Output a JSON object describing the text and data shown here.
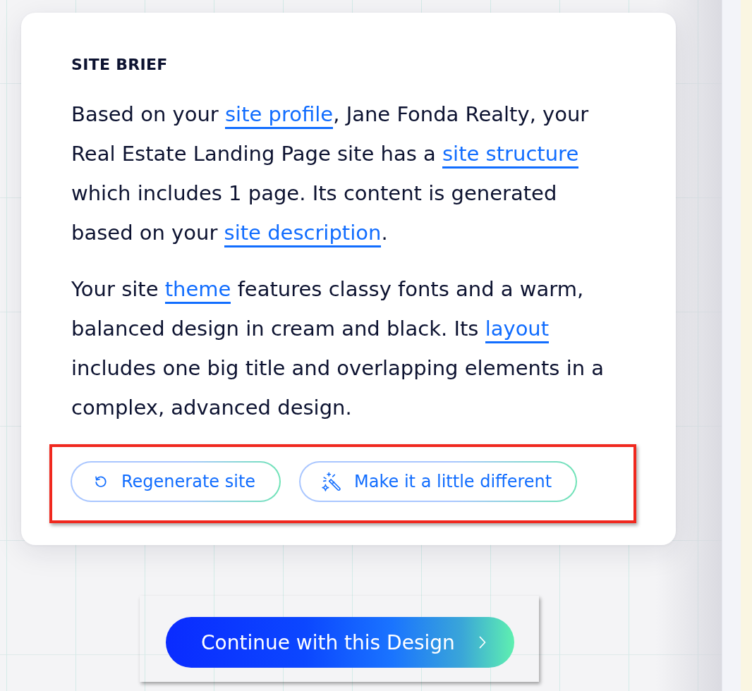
{
  "brief": {
    "title": "SITE BRIEF",
    "paragraphs": [
      {
        "segments": [
          {
            "kind": "text",
            "text": "Based on your "
          },
          {
            "kind": "link",
            "text": "site profile"
          },
          {
            "kind": "text",
            "text": ", Jane Fonda Realty, your Real Estate Landing Page site has a "
          },
          {
            "kind": "link",
            "text": "site structure"
          },
          {
            "kind": "text",
            "text": " which includes 1 page. Its content is generated based on your "
          },
          {
            "kind": "link",
            "text": "site description"
          },
          {
            "kind": "text",
            "text": "."
          }
        ]
      },
      {
        "segments": [
          {
            "kind": "text",
            "text": "Your site "
          },
          {
            "kind": "link",
            "text": "theme"
          },
          {
            "kind": "text",
            "text": " features classy fonts and a warm, balanced design in cream and black. Its "
          },
          {
            "kind": "link",
            "text": "layout"
          },
          {
            "kind": "text",
            "text": " includes one big title and overlapping elements in a complex, advanced design."
          }
        ]
      }
    ]
  },
  "actions": {
    "highlighted": true,
    "buttons": [
      {
        "kind": "regenerate",
        "label": "Regenerate site"
      },
      {
        "kind": "variation",
        "label": "Make it a little different"
      }
    ]
  },
  "primary": {
    "highlighted": true,
    "label": "Continue with this Design"
  }
}
